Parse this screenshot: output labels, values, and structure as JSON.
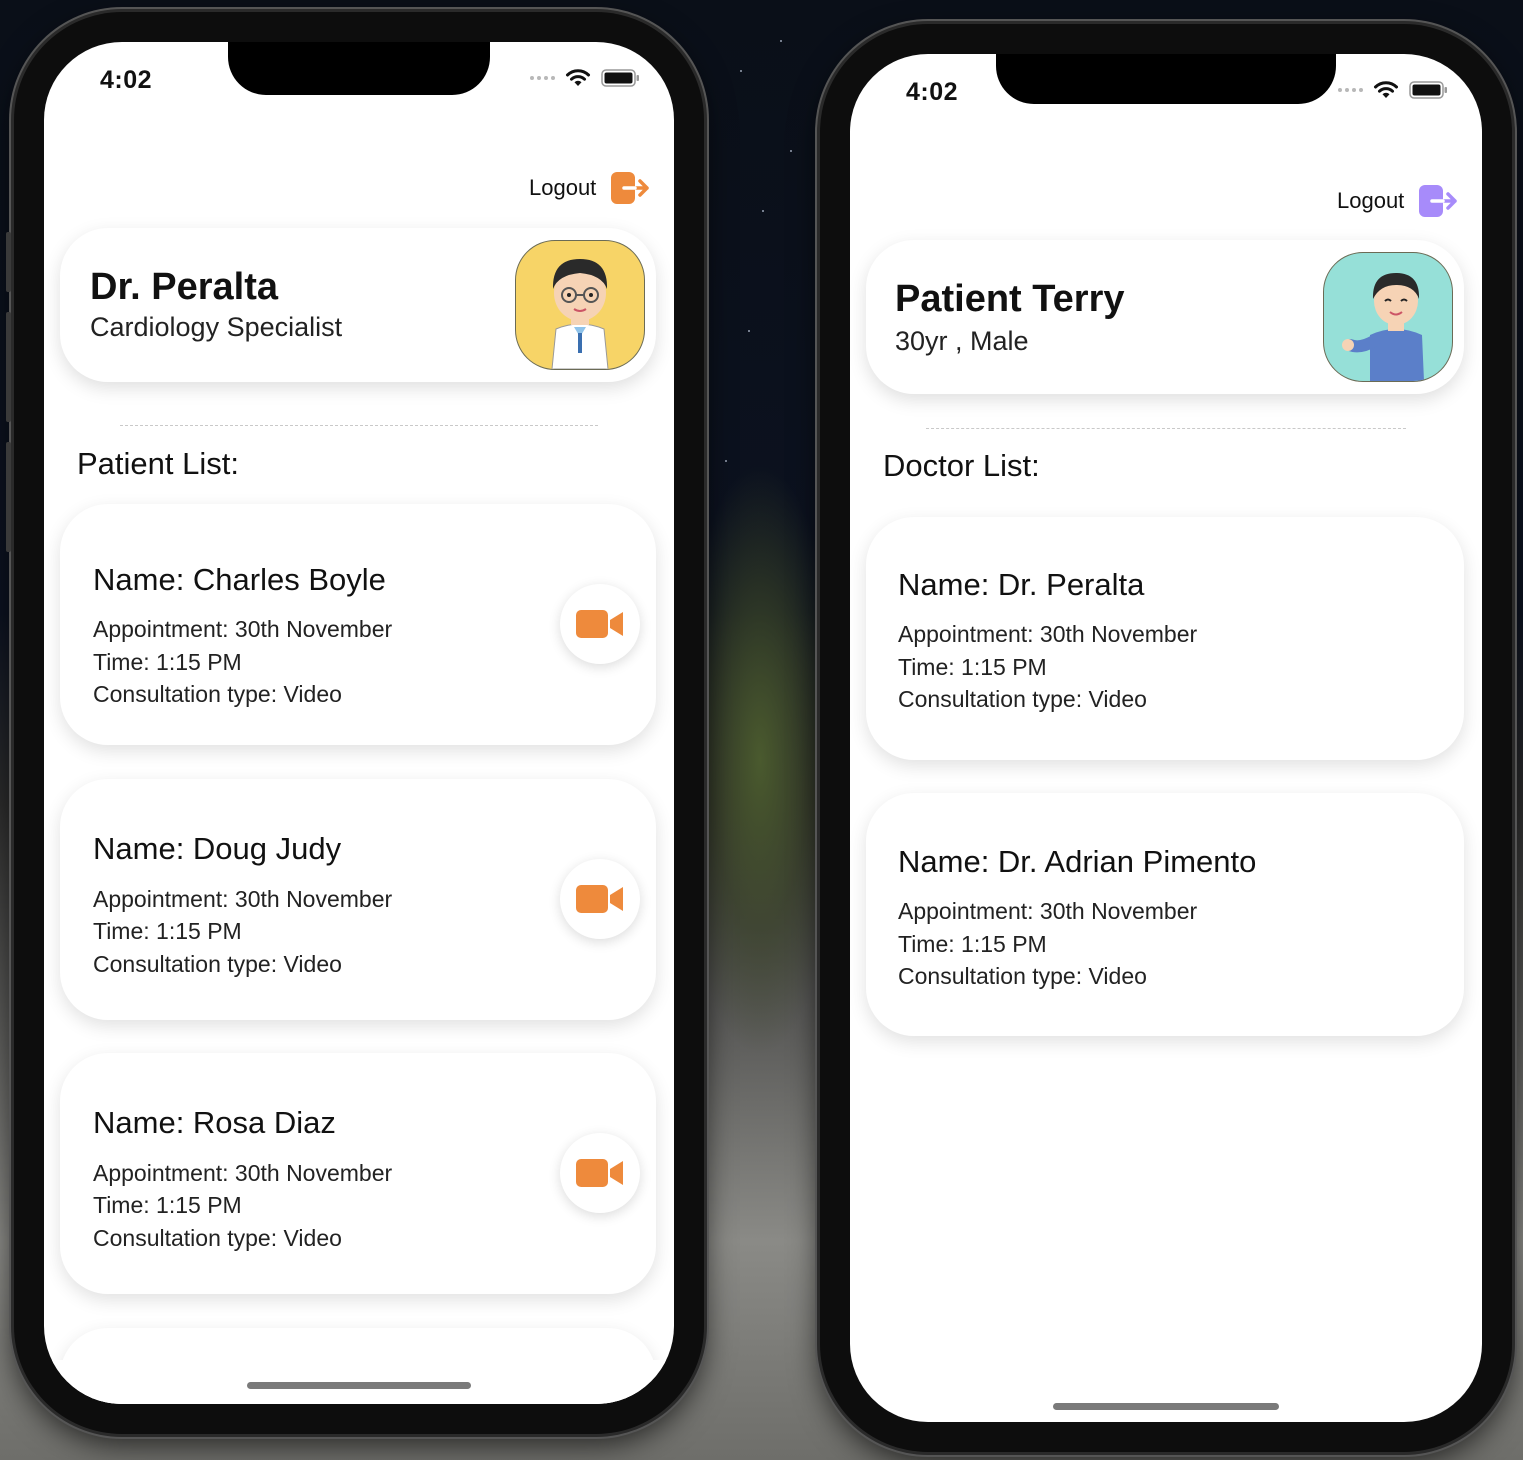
{
  "doctor_app": {
    "status_time": "4:02",
    "logout_label": "Logout",
    "accent_color": "#ee8a3c",
    "profile": {
      "name": "Dr. Peralta",
      "subtitle": "Cardiology Specialist"
    },
    "list_title": "Patient List:",
    "patients": [
      {
        "name": "Name: Charles Boyle",
        "appointment": "Appointment: 30th November",
        "time": "Time: 1:15 PM",
        "type": "Consultation type: Video"
      },
      {
        "name": "Name: Doug Judy",
        "appointment": "Appointment: 30th November",
        "time": "Time: 1:15 PM",
        "type": "Consultation type: Video"
      },
      {
        "name": "Name: Rosa Diaz",
        "appointment": "Appointment: 30th November",
        "time": "Time: 1:15 PM",
        "type": "Consultation type: Video"
      }
    ]
  },
  "patient_app": {
    "status_time": "4:02",
    "logout_label": "Logout",
    "accent_color": "#a78bfa",
    "profile": {
      "name": "Patient Terry",
      "subtitle": "30yr , Male"
    },
    "list_title": "Doctor List:",
    "doctors": [
      {
        "name": "Name: Dr. Peralta",
        "appointment": "Appointment: 30th November",
        "time": "Time: 1:15 PM",
        "type": "Consultation type: Video"
      },
      {
        "name": "Name: Dr. Adrian Pimento",
        "appointment": "Appointment: 30th November",
        "time": "Time: 1:15 PM",
        "type": "Consultation type: Video"
      }
    ]
  },
  "icons": {
    "logout": "logout-icon",
    "video": "video-camera-icon",
    "wifi": "wifi-icon",
    "battery": "battery-icon",
    "cellular": "cellular-signal-icon"
  }
}
